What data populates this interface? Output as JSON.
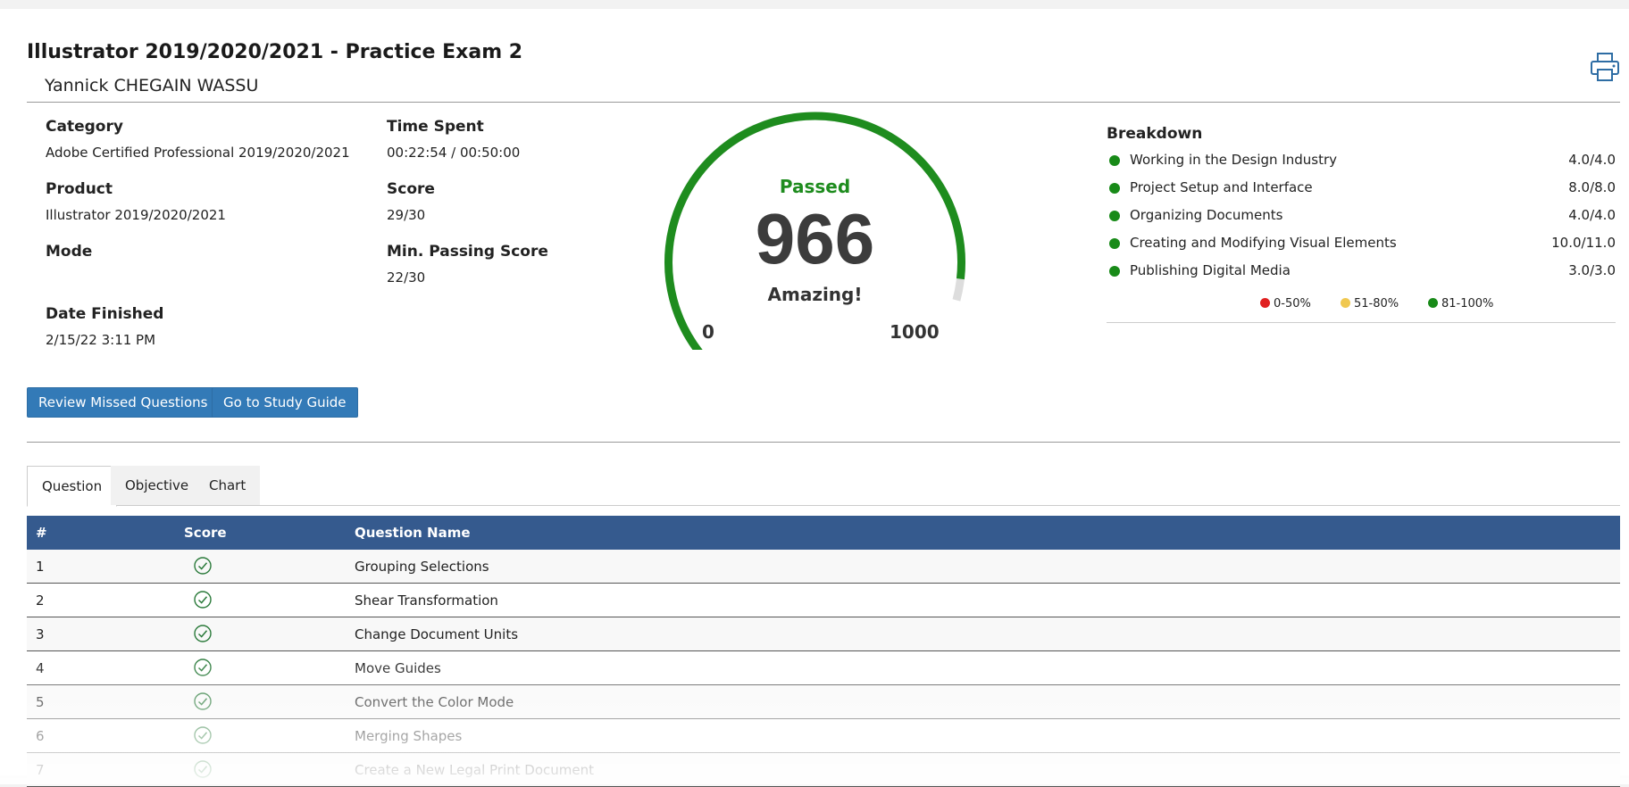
{
  "header": {
    "title": "Illustrator 2019/2020/2021 - Practice Exam 2",
    "user_name": "Yannick CHEGAIN WASSU"
  },
  "info": {
    "category_label": "Category",
    "category_value": "Adobe Certified Professional 2019/2020/2021",
    "product_label": "Product",
    "product_value": "Illustrator 2019/2020/2021",
    "mode_label": "Mode",
    "mode_value": "",
    "date_label": "Date Finished",
    "date_value": "2/15/22 3:11 PM",
    "time_label": "Time Spent",
    "time_value": "00:22:54 / 00:50:00",
    "score_label": "Score",
    "score_value": "29/30",
    "min_label": "Min. Passing Score",
    "min_value": "22/30"
  },
  "gauge": {
    "status": "Passed",
    "score": "966",
    "score_fraction": 0.966,
    "remark": "Amazing!",
    "min": "0",
    "max": "1000",
    "color_fill": "#1e8c1e",
    "color_track": "#dddddd"
  },
  "actions": {
    "review_label": "Review Missed Questions",
    "study_label": "Go to Study Guide"
  },
  "breakdown": {
    "title": "Breakdown",
    "items": [
      {
        "name": "Working in the Design Industry",
        "score": "4.0/4.0"
      },
      {
        "name": "Project Setup and Interface",
        "score": "8.0/8.0"
      },
      {
        "name": "Organizing Documents",
        "score": "4.0/4.0"
      },
      {
        "name": "Creating and Modifying Visual Elements",
        "score": "10.0/11.0"
      },
      {
        "name": "Publishing Digital Media",
        "score": "3.0/3.0"
      }
    ],
    "legend": [
      {
        "label": "0-50%",
        "color": "#e02020"
      },
      {
        "label": "51-80%",
        "color": "#f0c850"
      },
      {
        "label": "81-100%",
        "color": "#188a18"
      }
    ]
  },
  "tabs": [
    {
      "label": "Question"
    },
    {
      "label": "Objective"
    },
    {
      "label": "Chart"
    }
  ],
  "table": {
    "headers": {
      "num": "#",
      "score": "Score",
      "name": "Question Name"
    },
    "rows": [
      {
        "num": "1",
        "name": "Grouping Selections"
      },
      {
        "num": "2",
        "name": "Shear Transformation"
      },
      {
        "num": "3",
        "name": "Change Document Units"
      },
      {
        "num": "4",
        "name": "Move Guides"
      },
      {
        "num": "5",
        "name": "Convert the Color Mode"
      },
      {
        "num": "6",
        "name": "Merging Shapes"
      },
      {
        "num": "7",
        "name": "Create a New Legal Print Document"
      }
    ]
  }
}
